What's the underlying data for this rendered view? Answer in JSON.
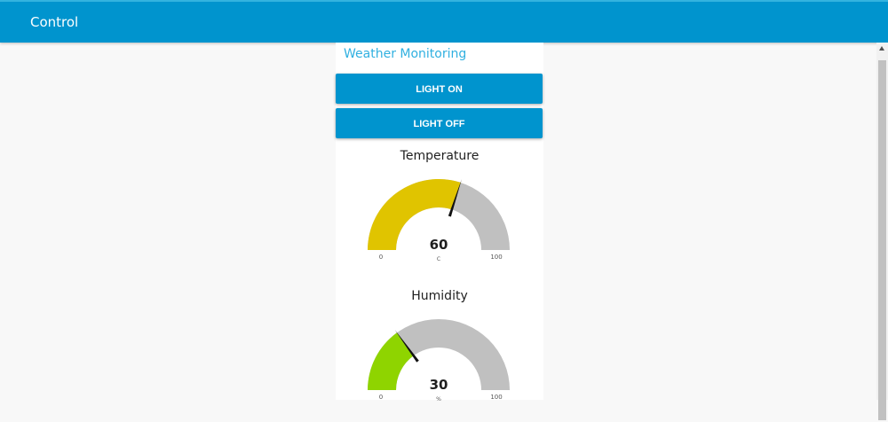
{
  "header": {
    "title": "Control"
  },
  "group": {
    "title": "Weather Monitoring"
  },
  "buttons": {
    "light_on": "LIGHT ON",
    "light_off": "LIGHT OFF"
  },
  "gauges": [
    {
      "title": "Temperature",
      "value": 60,
      "value_label": "60",
      "unit": "C",
      "min": 0,
      "max": 100,
      "min_label": "0",
      "max_label": "100",
      "color": "#e0c400"
    },
    {
      "title": "Humidity",
      "value": 30,
      "value_label": "30",
      "unit": "%",
      "min": 0,
      "max": 100,
      "min_label": "0",
      "max_label": "100",
      "color": "#8fd400"
    }
  ],
  "colors": {
    "accent": "#0094ce",
    "group_title": "#30b0e0",
    "gauge_background": "#c0c0c0"
  }
}
